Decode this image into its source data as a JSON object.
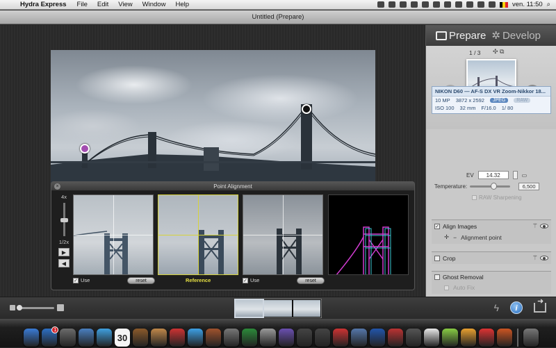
{
  "menubar": {
    "app_name": "Hydra Express",
    "menus": [
      "File",
      "Edit",
      "View",
      "Window",
      "Help"
    ],
    "clock": "ven. 11:50",
    "flag_colors": [
      "#000000",
      "#f5d20a",
      "#e0232b"
    ]
  },
  "window": {
    "title": "Untitled (Prepare)"
  },
  "point_alignment": {
    "title": "Point Alignment",
    "zoom_max": "4x",
    "zoom_min": "1/2x",
    "frames": [
      {
        "use_label": "Use",
        "reset_label": "reset"
      },
      {
        "reference_label": "Reference"
      },
      {
        "use_label": "Use",
        "reset_label": "reset"
      }
    ]
  },
  "right_panel": {
    "tab_prepare": "Prepare",
    "tab_develop": "Develop",
    "counter": "1 / 3",
    "camera": {
      "model": "NIKON D60 — AF-S DX VR Zoom-Nikkor 18...",
      "megapixels": "10 MP",
      "resolution": "3872 x 2592",
      "format_active": "JPEG",
      "format_inactive": "RAW",
      "iso": "ISO 100",
      "focal": "32 mm",
      "aperture": "F/16.0",
      "shutter": "1/ 80"
    },
    "adjust": {
      "ev_label": "EV",
      "ev_value": "14.32",
      "temperature_label": "Temperature:",
      "temperature_value": "6,500",
      "raw_sharpening_label": "RAW Sharpening"
    },
    "sections": {
      "align_label": "Align Images",
      "alignment_point_label": "Alignment point",
      "crop_label": "Crop",
      "ghost_label": "Ghost Removal",
      "auto_fix_label": "Auto Fix"
    }
  },
  "dock": {
    "calendar_day": "30",
    "appstore_badge": "1",
    "icon_colors": [
      "#3a7bd5",
      "#2d6fc4",
      "#6b6b6b",
      "#4a7fc0",
      "#3fa0e0",
      "#d9d9d9",
      "#8b5a2b",
      "#c0884a",
      "#cc3333",
      "#3da0e5",
      "#a0522d",
      "#777777",
      "#2c8a3a",
      "#999999",
      "#6a4fb0",
      "#444444",
      "#444444",
      "#c33",
      "#5577aa",
      "#2255aa",
      "#bb3333",
      "#555555",
      "#e8e8e8",
      "#88cc44",
      "#e8a030",
      "#d33",
      "#cc5522",
      "#777777"
    ]
  }
}
